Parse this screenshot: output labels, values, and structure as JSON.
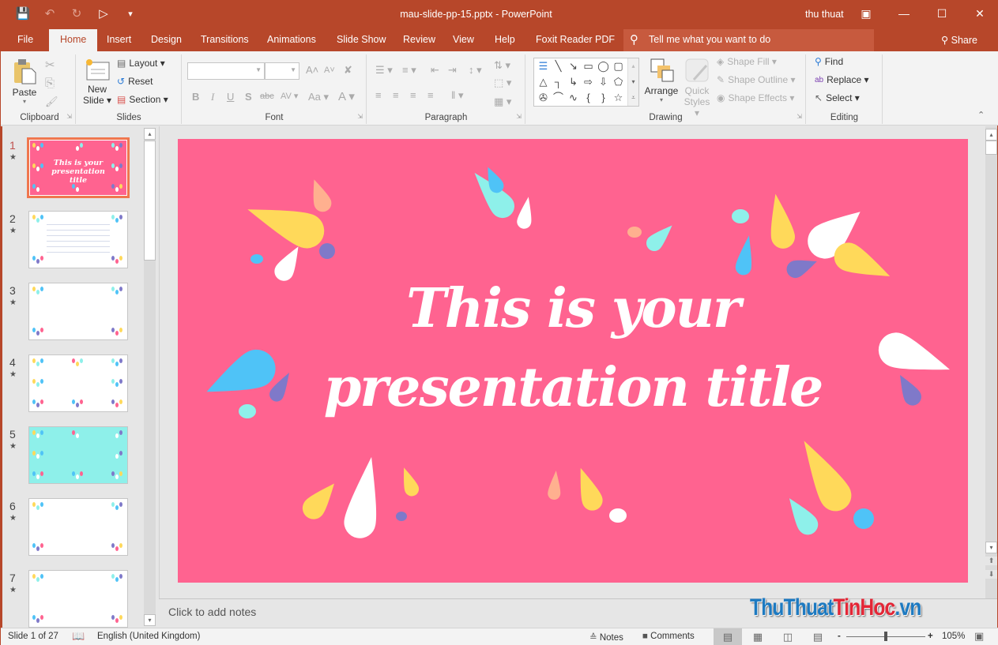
{
  "window": {
    "title": "mau-slide-pp-15.pptx  -  PowerPoint",
    "user": "thu thuat",
    "qat": {
      "save": "💾",
      "undo": "↶",
      "redo": "↻",
      "start": "▶",
      "more": "≡"
    },
    "buttons": {
      "restore_ribbon": "▣",
      "minimize": "—",
      "maximize": "☐",
      "close": "✕"
    }
  },
  "tabs": [
    {
      "label": "File"
    },
    {
      "label": "Home"
    },
    {
      "label": "Insert"
    },
    {
      "label": "Design"
    },
    {
      "label": "Transitions"
    },
    {
      "label": "Animations"
    },
    {
      "label": "Slide Show"
    },
    {
      "label": "Review"
    },
    {
      "label": "View"
    },
    {
      "label": "Help"
    },
    {
      "label": "Foxit Reader PDF"
    }
  ],
  "active_tab": "Home",
  "tell_me": {
    "placeholder": "Tell me what you want to do",
    "icon": "💡"
  },
  "share": {
    "label": "Share",
    "icon": "👤"
  },
  "ribbon": {
    "clipboard": {
      "label": "Clipboard",
      "paste": "Paste",
      "paste_arrow": "▾",
      "cut": "✂",
      "copy": "⎘",
      "format_painter": "🖌"
    },
    "slides": {
      "label": "Slides",
      "new_slide_line1": "New",
      "new_slide_line2": "Slide ▾",
      "layout": "Layout ▾",
      "reset": "Reset",
      "section": "Section ▾"
    },
    "font": {
      "label": "Font",
      "font_name": "",
      "font_size": "",
      "grow": "A˄",
      "shrink": "A˅",
      "clear": "✘",
      "bold": "B",
      "italic": "I",
      "underline": "U",
      "shadow": "S",
      "strike": "abc",
      "spacing": "AV ▾",
      "case": "Aa ▾",
      "color": "A ▾"
    },
    "paragraph": {
      "label": "Paragraph",
      "bullets": "☰ ▾",
      "numbering": "≡ ▾",
      "dec_indent": "⇤",
      "inc_indent": "⇥",
      "line_spacing": "↕ ▾",
      "text_direction": "⇅ ▾",
      "align_text": "⬚ ▾",
      "smartart": "▦ ▾",
      "align_left": "≡",
      "center": "≡",
      "align_right": "≡",
      "justify": "≡",
      "columns": "‖ ▾"
    },
    "drawing": {
      "label": "Drawing",
      "arrange": "Arrange",
      "arrange_arrow": "▾",
      "quick_styles_1": "Quick",
      "quick_styles_2": "Styles ▾",
      "shape_fill": "Shape Fill ▾",
      "shape_outline": "Shape Outline ▾",
      "shape_effects": "Shape Effects ▾",
      "shapes": [
        "☰",
        "╲",
        "↘",
        "▭",
        "◯",
        "▢",
        "△",
        "┐",
        "↳",
        "⇨",
        "⇩",
        "⬠",
        "✇",
        "⌒",
        "∿",
        "{",
        "}",
        "☆"
      ],
      "scroll_up": "▴",
      "scroll_down": "▾",
      "more": "⩡"
    },
    "editing": {
      "label": "Editing",
      "find": "Find",
      "replace": "Replace ▾",
      "select": "Select ▾",
      "collapse": "⌃"
    }
  },
  "thumbnails": [
    {
      "number": "1",
      "star": "★",
      "title": "This is your presentation title",
      "bg": "#ff6390"
    },
    {
      "number": "2",
      "star": "★",
      "bg": "#ffffff"
    },
    {
      "number": "3",
      "star": "★",
      "bg": "#ffffff"
    },
    {
      "number": "4",
      "star": "★",
      "bg": "#ffffff"
    },
    {
      "number": "5",
      "star": "★",
      "bg": "#8ef0ea"
    },
    {
      "number": "6",
      "star": "★",
      "bg": "#ffffff"
    },
    {
      "number": "7",
      "star": "★",
      "bg": "#ffffff"
    }
  ],
  "slide": {
    "title_line1": "This is your",
    "title_line2": "presentation title",
    "background": "#ff6390",
    "palette": {
      "yellow": "#ffd95a",
      "cyan": "#8ef0ea",
      "blue": "#4fc3f7",
      "purple": "#7f79c9",
      "peach": "#ffb08f",
      "white": "#ffffff"
    }
  },
  "notes": {
    "placeholder": "Click to add notes"
  },
  "watermark": {
    "part1": "ThuThuat",
    "part2": "TinHoc",
    "part3": ".vn"
  },
  "status": {
    "slide_info": "Slide 1 of 27",
    "language": "English (United Kingdom)",
    "notes": "Notes",
    "comments": "Comments",
    "zoom": "105%",
    "zoom_minus": "-",
    "zoom_plus": "+",
    "zoom_fraction": 0.5
  },
  "scroll": {
    "up": "▴",
    "down": "▾",
    "prev_slide": "⬆",
    "next_slide": "⬇"
  }
}
